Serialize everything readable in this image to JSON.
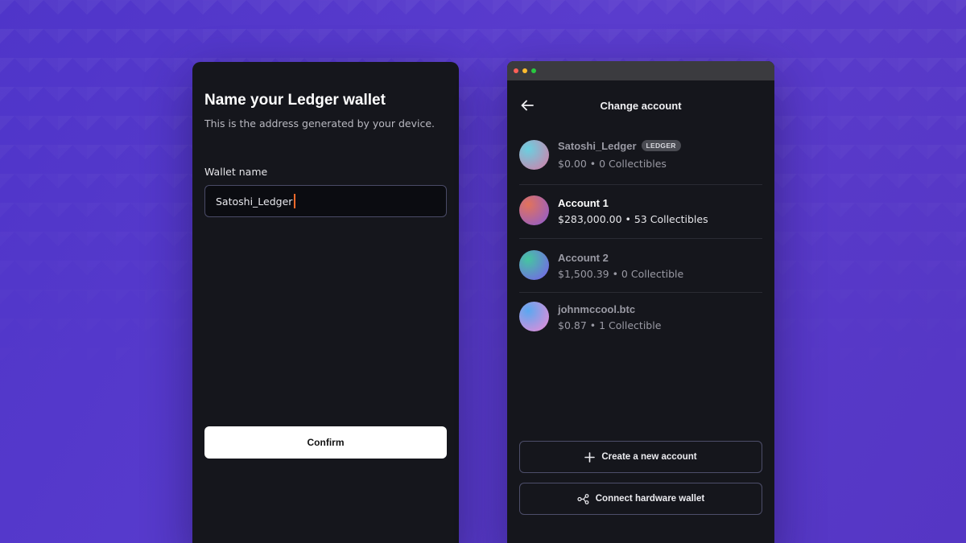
{
  "wallet_form": {
    "title": "Name your Ledger wallet",
    "subtitle": "This is the address generated by your device.",
    "field_label": "Wallet name",
    "field_value": "Satoshi_Ledger",
    "confirm_label": "Confirm"
  },
  "account_switcher": {
    "title": "Change account",
    "accounts": [
      {
        "name": "Satoshi_Ledger",
        "badge": "LEDGER",
        "summary": "$0.00 • 0 Collectibles",
        "active": false,
        "gradient": [
          "#6ad0e0",
          "#d97aa6"
        ]
      },
      {
        "name": "Account 1",
        "badge": "",
        "summary": "$283,000.00 • 53 Collectibles",
        "active": true,
        "gradient": [
          "#e2735a",
          "#8a5bd6"
        ]
      },
      {
        "name": "Account 2",
        "badge": "",
        "summary": "$1,500.39 • 0 Collectible",
        "active": false,
        "gradient": [
          "#45c6a0",
          "#7b5cf0"
        ]
      },
      {
        "name": "johnmccool.btc",
        "badge": "",
        "summary": "$0.87 • 1 Collectible",
        "active": false,
        "gradient": [
          "#5aa8f0",
          "#f08ad6"
        ]
      }
    ],
    "create_account_label": "Create a new account",
    "connect_hardware_label": "Connect hardware wallet"
  },
  "colors": {
    "background": "#5a3ccd",
    "panel": "#15161c",
    "caret": "#ff6a2b",
    "window_dots": [
      "#ff5f57",
      "#febc2e",
      "#28c840"
    ]
  }
}
